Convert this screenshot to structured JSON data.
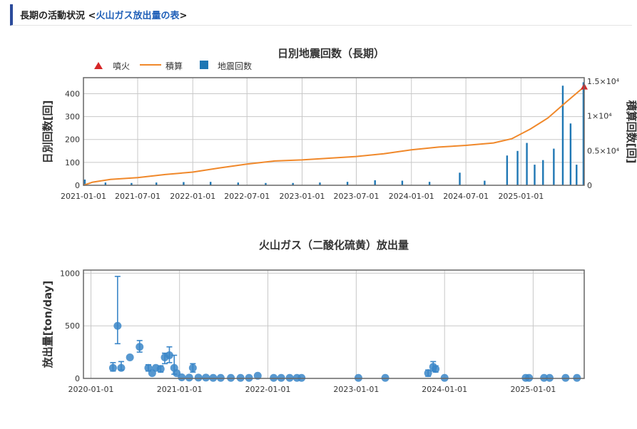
{
  "header": {
    "prefix": "長期の活動状況 ",
    "open": "<",
    "link": "火山ガス放出量の表",
    "close": ">"
  },
  "colors": {
    "accent": "#2b4b9b",
    "link": "#1f5fb8",
    "bars": "#1f77b4",
    "cumulative": "#f0882a",
    "eruption": "#d62728",
    "gas_points": "#3a86c8"
  },
  "chart_data": [
    {
      "type": "bar",
      "title": "日別地震回数（長期）",
      "ylabel": "日別回数[回]",
      "y2label": "積算回数[回]",
      "legend": [
        "噴火",
        "積算",
        "地震回数"
      ],
      "legend_position": "top-left",
      "x_ticks": [
        "2021-01-01",
        "2021-07-01",
        "2022-01-01",
        "2022-07-01",
        "2023-01-01",
        "2023-07-01",
        "2024-01-01",
        "2024-07-01",
        "2025-01-01"
      ],
      "xlim": [
        "2021-01-01",
        "2025-07-31"
      ],
      "ylim": [
        0,
        470
      ],
      "y_ticks": [
        0,
        100,
        200,
        300,
        400
      ],
      "y2lim": [
        0,
        15500
      ],
      "y2_ticks": [
        "0",
        "0.5×10⁴",
        "1×10⁴",
        "1.5×10⁴"
      ],
      "grid": true,
      "series": [
        {
          "name": "地震回数",
          "style": "bar",
          "points": [
            [
              "2021-01-05",
              25
            ],
            [
              "2021-03-15",
              12
            ],
            [
              "2021-06-10",
              10
            ],
            [
              "2021-09-01",
              12
            ],
            [
              "2021-12-01",
              14
            ],
            [
              "2022-03-01",
              15
            ],
            [
              "2022-06-01",
              12
            ],
            [
              "2022-09-01",
              10
            ],
            [
              "2022-12-01",
              10
            ],
            [
              "2023-03-01",
              12
            ],
            [
              "2023-06-01",
              15
            ],
            [
              "2023-09-01",
              22
            ],
            [
              "2023-12-01",
              20
            ],
            [
              "2024-03-01",
              15
            ],
            [
              "2024-06-10",
              55
            ],
            [
              "2024-09-01",
              20
            ],
            [
              "2024-11-15",
              130
            ],
            [
              "2024-12-20",
              150
            ],
            [
              "2025-01-20",
              185
            ],
            [
              "2025-02-15",
              90
            ],
            [
              "2025-03-15",
              110
            ],
            [
              "2025-04-20",
              160
            ],
            [
              "2025-05-20",
              435
            ],
            [
              "2025-06-15",
              270
            ],
            [
              "2025-07-05",
              90
            ],
            [
              "2025-07-28",
              450
            ]
          ]
        },
        {
          "name": "積算",
          "style": "line",
          "points": [
            [
              "2021-01-01",
              0
            ],
            [
              "2021-02-01",
              450
            ],
            [
              "2021-04-01",
              850
            ],
            [
              "2021-07-01",
              1100
            ],
            [
              "2021-10-01",
              1550
            ],
            [
              "2022-01-01",
              1900
            ],
            [
              "2022-04-01",
              2500
            ],
            [
              "2022-07-01",
              3050
            ],
            [
              "2022-10-01",
              3500
            ],
            [
              "2023-01-01",
              3650
            ],
            [
              "2023-04-01",
              3900
            ],
            [
              "2023-07-01",
              4150
            ],
            [
              "2023-10-01",
              4550
            ],
            [
              "2024-01-01",
              5100
            ],
            [
              "2024-04-01",
              5500
            ],
            [
              "2024-07-01",
              5750
            ],
            [
              "2024-10-01",
              6100
            ],
            [
              "2024-12-01",
              6700
            ],
            [
              "2025-02-01",
              8100
            ],
            [
              "2025-04-01",
              9700
            ],
            [
              "2025-06-01",
              12000
            ],
            [
              "2025-07-31",
              14200
            ]
          ]
        },
        {
          "name": "噴火",
          "style": "marker",
          "points": [
            [
              "2025-07-31",
              14200
            ]
          ]
        }
      ]
    },
    {
      "type": "scatter",
      "title": "火山ガス（二酸化硫黄）放出量",
      "ylabel": "放出量[ton/day]",
      "x_ticks": [
        "2020-01-01",
        "2021-01-01",
        "2022-01-01",
        "2023-01-01",
        "2024-01-01",
        "2025-01-01"
      ],
      "xlim": [
        "2019-12-01",
        "2025-07-31"
      ],
      "ylim": [
        0,
        1030
      ],
      "y_ticks": [
        0,
        500,
        1000
      ],
      "grid": true,
      "points": [
        {
          "x": "2020-04-01",
          "y": 100,
          "lo": 70,
          "hi": 150
        },
        {
          "x": "2020-04-20",
          "y": 500,
          "lo": 330,
          "hi": 970
        },
        {
          "x": "2020-05-05",
          "y": 100,
          "lo": 80,
          "hi": 160
        },
        {
          "x": "2020-06-10",
          "y": 200
        },
        {
          "x": "2020-07-20",
          "y": 300,
          "lo": 250,
          "hi": 360
        },
        {
          "x": "2020-08-25",
          "y": 100,
          "lo": 70,
          "hi": 130
        },
        {
          "x": "2020-09-10",
          "y": 50
        },
        {
          "x": "2020-09-25",
          "y": 100
        },
        {
          "x": "2020-10-15",
          "y": 90,
          "lo": 60,
          "hi": 120
        },
        {
          "x": "2020-11-01",
          "y": 200,
          "lo": 140,
          "hi": 240
        },
        {
          "x": "2020-11-20",
          "y": 220,
          "lo": 150,
          "hi": 300
        },
        {
          "x": "2020-12-10",
          "y": 100,
          "lo": 40,
          "hi": 220
        },
        {
          "x": "2020-12-20",
          "y": 50
        },
        {
          "x": "2021-01-10",
          "y": 10
        },
        {
          "x": "2021-02-10",
          "y": 8
        },
        {
          "x": "2021-02-25",
          "y": 100,
          "lo": 60,
          "hi": 140
        },
        {
          "x": "2021-03-20",
          "y": 8
        },
        {
          "x": "2021-04-20",
          "y": 8
        },
        {
          "x": "2021-05-20",
          "y": 5
        },
        {
          "x": "2021-06-20",
          "y": 5
        },
        {
          "x": "2021-08-01",
          "y": 5
        },
        {
          "x": "2021-09-10",
          "y": 5
        },
        {
          "x": "2021-10-15",
          "y": 5
        },
        {
          "x": "2021-11-20",
          "y": 25
        },
        {
          "x": "2022-01-25",
          "y": 5
        },
        {
          "x": "2022-02-25",
          "y": 5
        },
        {
          "x": "2022-04-01",
          "y": 5
        },
        {
          "x": "2022-05-01",
          "y": 5
        },
        {
          "x": "2022-05-20",
          "y": 5
        },
        {
          "x": "2023-01-10",
          "y": 5
        },
        {
          "x": "2023-05-01",
          "y": 5
        },
        {
          "x": "2023-10-25",
          "y": 50,
          "lo": 20,
          "hi": 80
        },
        {
          "x": "2023-11-15",
          "y": 110,
          "lo": 70,
          "hi": 160
        },
        {
          "x": "2023-11-25",
          "y": 90,
          "lo": 60,
          "hi": 120
        },
        {
          "x": "2024-01-01",
          "y": 5
        },
        {
          "x": "2024-12-01",
          "y": 5
        },
        {
          "x": "2024-12-15",
          "y": 5
        },
        {
          "x": "2025-02-15",
          "y": 5
        },
        {
          "x": "2025-03-10",
          "y": 5
        },
        {
          "x": "2025-05-15",
          "y": 5
        },
        {
          "x": "2025-07-01",
          "y": 5
        }
      ]
    }
  ]
}
